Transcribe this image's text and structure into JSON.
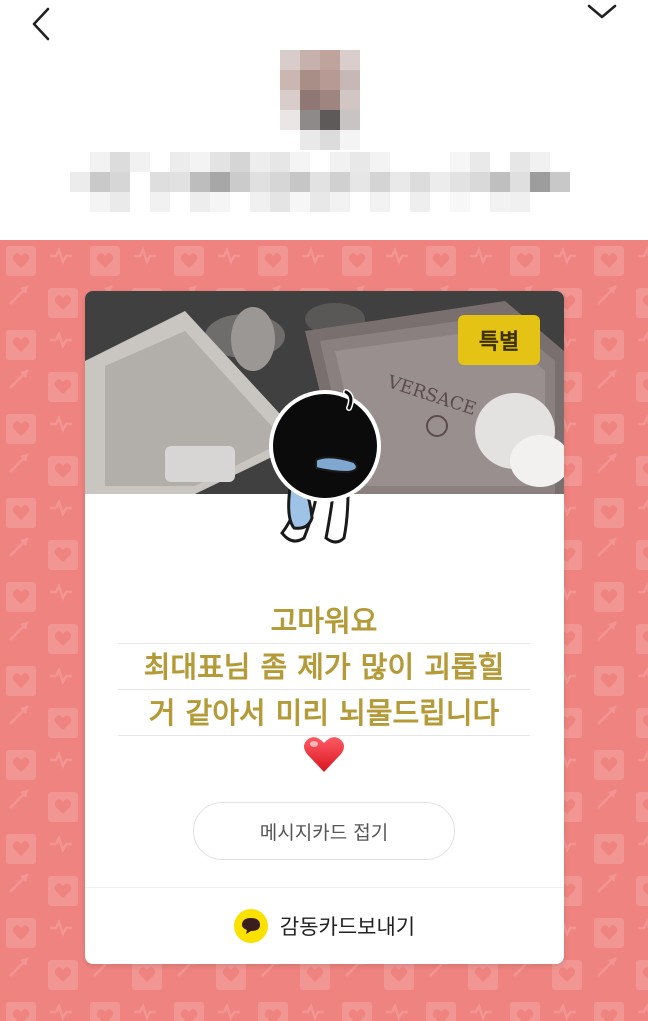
{
  "header": {
    "back_icon": "chevron-left-icon",
    "more_icon": "chevron-down-icon",
    "avatar": "blurred-profile-photo",
    "sender_name": "blurred-sender-name"
  },
  "card": {
    "badge_label": "특별",
    "photo": "versace-gift-box-photo",
    "message_lines": [
      "고마워요",
      "최대표님 좀 제가 많이 괴롭힐",
      "거 같아서 미리 뇌물드립니다"
    ],
    "emoji": "red-heart",
    "fold_button_label": "메시지카드 접기",
    "send_button_label": "감동카드보내기"
  },
  "colors": {
    "background_pattern": "#ef837f",
    "badge": "#e5c314",
    "message_text": "#b49b38",
    "talk_icon": "#fae100"
  }
}
